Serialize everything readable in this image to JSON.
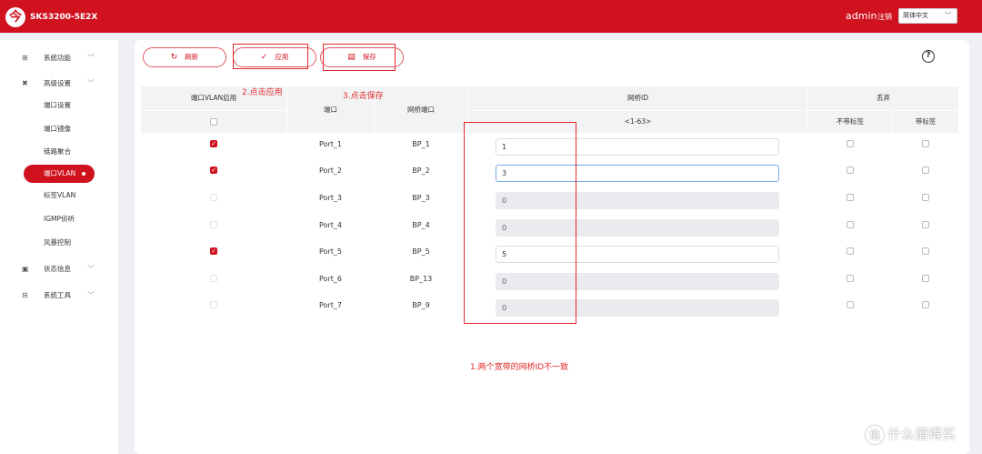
{
  "header": {
    "brand": "SKS3200-5E2X",
    "user": "admin",
    "logout": "注销",
    "language": "简体中文",
    "bg": "#d0121f"
  },
  "sidebar": {
    "system": "系统功能",
    "advanced": "高级设置",
    "sub": [
      "端口设置",
      "端口镜像",
      "链路聚合",
      "端口VLAN",
      "标签VLAN",
      "IGMP侦听",
      "风暴控制"
    ],
    "status": "状态信息",
    "tools": "系统工具"
  },
  "toolbar": {
    "refresh": "刷新",
    "apply": "应用",
    "save": "保存"
  },
  "table": {
    "col_enable": "端口VLAN启用",
    "col_port": "端口",
    "col_bridge_port": "网桥端口",
    "col_bridge_id": "网桥ID",
    "bridge_range": "<1-63>",
    "col_drop": "丢弃",
    "col_untagged": "不带标签",
    "col_tagged": "带标签",
    "rows": [
      {
        "enabled": true,
        "port": "Port_1",
        "bp": "BP_1",
        "id": "1",
        "state": "edit"
      },
      {
        "enabled": true,
        "port": "Port_2",
        "bp": "BP_2",
        "id": "3",
        "state": "focus"
      },
      {
        "enabled": false,
        "port": "Port_3",
        "bp": "BP_3",
        "id": "0",
        "state": "disabled"
      },
      {
        "enabled": false,
        "port": "Port_4",
        "bp": "BP_4",
        "id": "0",
        "state": "disabled"
      },
      {
        "enabled": true,
        "port": "Port_5",
        "bp": "BP_5",
        "id": "5",
        "state": "edit"
      },
      {
        "enabled": false,
        "port": "Port_6",
        "bp": "BP_13",
        "id": "0",
        "state": "disabled"
      },
      {
        "enabled": false,
        "port": "Port_7",
        "bp": "BP_9",
        "id": "0",
        "state": "disabled"
      }
    ]
  },
  "annotations": {
    "step1": "1.两个宽带的网桥ID不一致",
    "step2": "2.点击应用",
    "step3": "3.点击保存",
    "color": "#e02a2a"
  },
  "watermark": "什么值得买"
}
